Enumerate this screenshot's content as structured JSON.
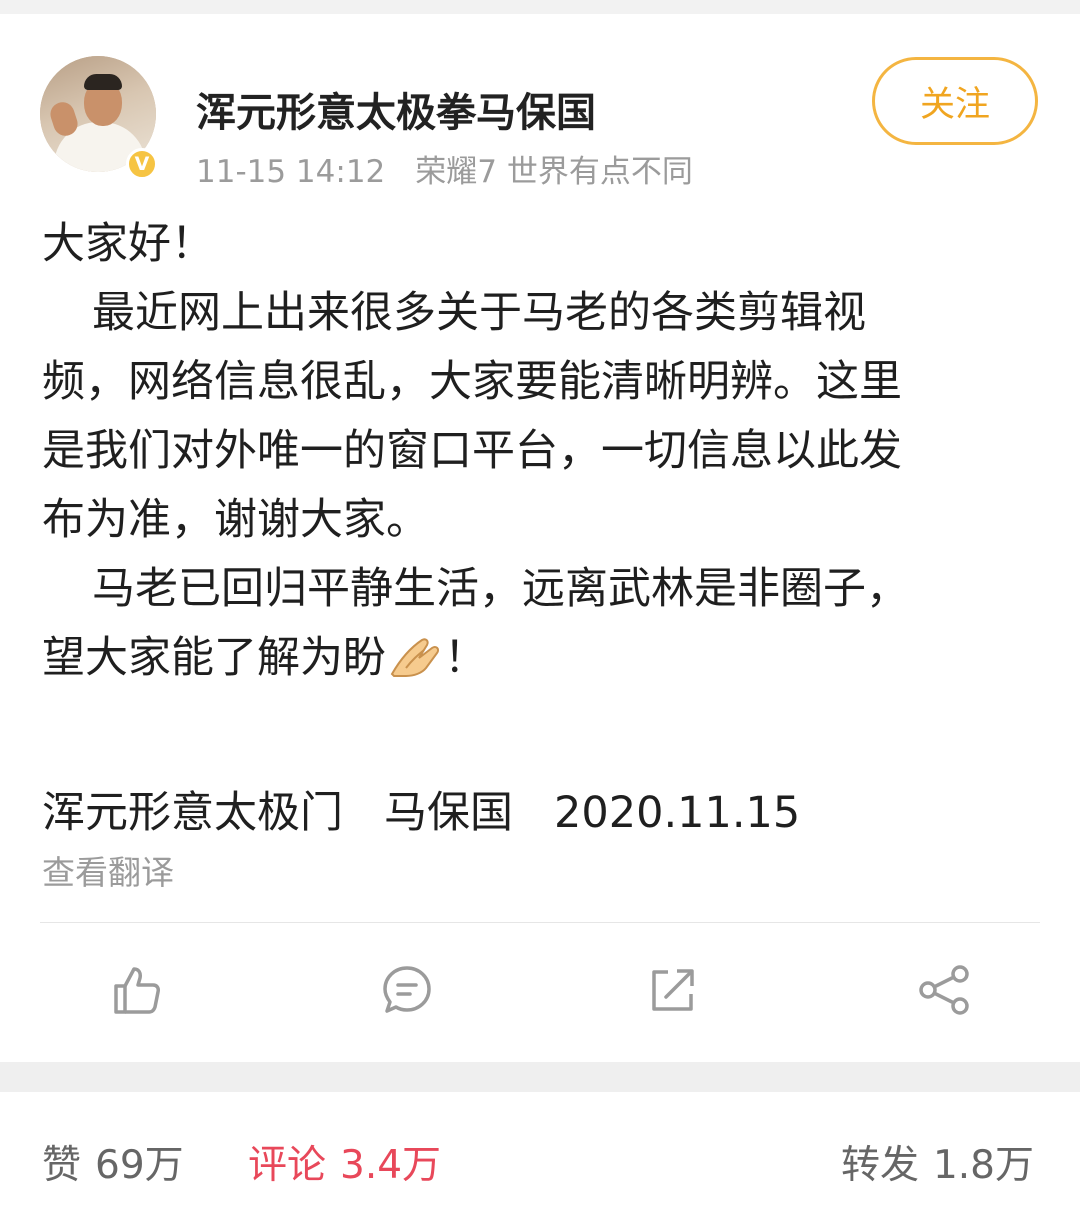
{
  "post": {
    "username": "浑元形意太极拳马保国",
    "verified_badge": "V",
    "time": "11-15 14:12",
    "source": "荣耀7 世界有点不同",
    "follow_label": "关注",
    "content_lines": [
      "大家好！",
      "最近网上出来很多关于马老的各类剪辑视",
      "频，网络信息很乱，大家要能清晰明辨。这里",
      "是我们对外唯一的窗口平台，一切信息以此发",
      "布为准，谢谢大家。",
      "马老已回归平静生活，远离武林是非圈子，",
      "望大家能了解为盼",
      "！"
    ],
    "emoji": "folded-hands-emoji",
    "signature": "浑元形意太极门   马保国   2020.11.15",
    "translate_label": "查看翻译"
  },
  "actions": {
    "icons": [
      "thumbs-up-icon",
      "comment-icon",
      "repost-icon",
      "share-icon"
    ],
    "icon_color": "#9b9b9b"
  },
  "stats": {
    "like_label": "赞",
    "like_count": "69万",
    "comment_label": "评论",
    "comment_count": "3.4万",
    "repost_label": "转发",
    "repost_count": "1.8万",
    "active_color": "#e8485a"
  },
  "colors": {
    "follow_accent": "#f4b541",
    "verified_badge": "#f6c443",
    "meta_gray": "#9b9b9b"
  }
}
